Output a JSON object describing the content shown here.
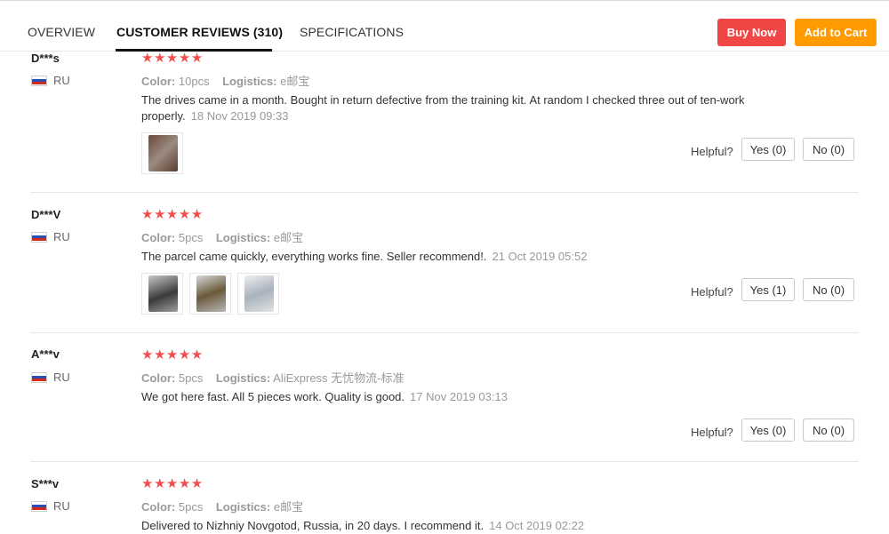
{
  "tabs": [
    {
      "label": "OVERVIEW"
    },
    {
      "label": "CUSTOMER REVIEWS (310)"
    },
    {
      "label": "SPECIFICATIONS"
    }
  ],
  "actions": {
    "buy_now": "Buy Now",
    "add_to_cart": "Add to Cart"
  },
  "colors": {
    "buy_now": "#f04646",
    "add_to_cart": "#ff9a00",
    "stars": "#f24e4e"
  },
  "labels": {
    "color": "Color:",
    "logistics": "Logistics:",
    "helpful": "Helpful?"
  },
  "reviews": [
    {
      "name": "D***s",
      "country": "RU",
      "stars": "★★★★★",
      "color": "10pcs",
      "logistics": "e邮宝",
      "text": "The drives came in a month. Bought in return defective from the training kit. At random I checked three out of ten-work properly.",
      "date": "18 Nov 2019 09:33",
      "yes": "Yes (0)",
      "no": "No (0)"
    },
    {
      "name": "D***V",
      "country": "RU",
      "stars": "★★★★★",
      "color": "5pcs",
      "logistics": "e邮宝",
      "text": "The parcel came quickly, everything works fine. Seller recommend!.",
      "date": "21 Oct 2019 05:52",
      "yes": "Yes (1)",
      "no": "No (0)"
    },
    {
      "name": "A***v",
      "country": "RU",
      "stars": "★★★★★",
      "color": "5pcs",
      "logistics": "AliExpress 无忧物流-标准",
      "text": "We got here fast. All 5 pieces work. Quality is good.",
      "date": "17 Nov 2019 03:13",
      "yes": "Yes (0)",
      "no": "No (0)"
    },
    {
      "name": "S***v",
      "country": "RU",
      "stars": "★★★★★",
      "color": "5pcs",
      "logistics": "e邮宝",
      "text": "Delivered to Nizhniy Novgotod, Russia, in 20 days. I recommend it.",
      "date": "14 Oct 2019 02:22"
    }
  ]
}
